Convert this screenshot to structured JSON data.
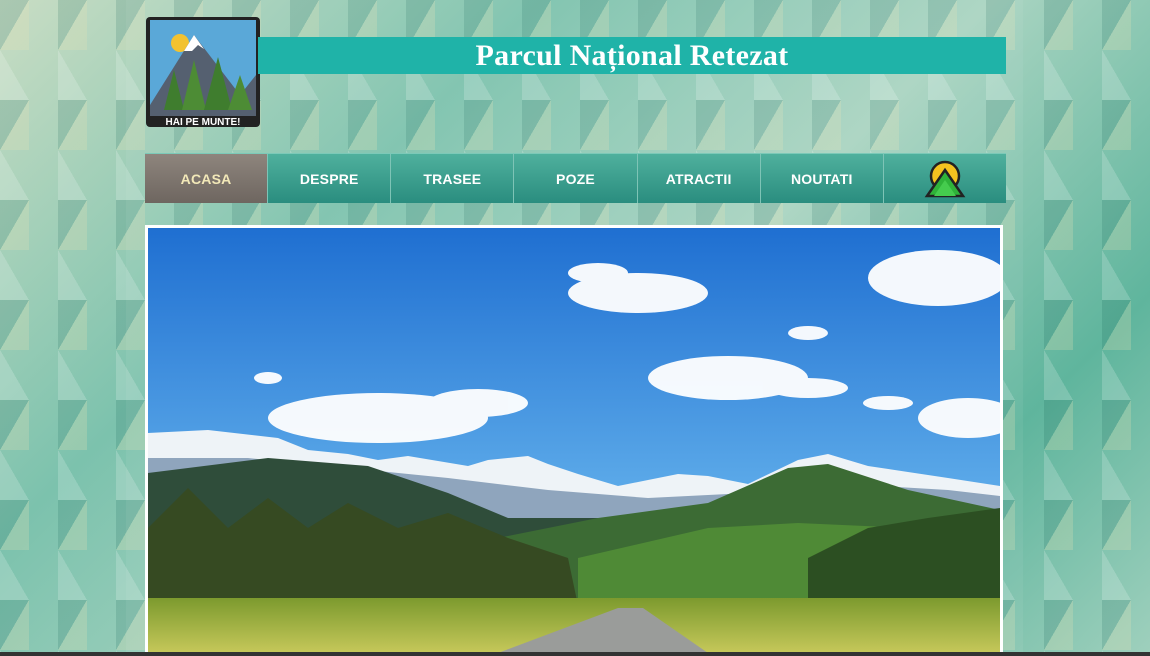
{
  "header": {
    "logo_text": "HAI PE MUNTE!",
    "title": "Parcul Național Retezat"
  },
  "nav": {
    "items": [
      {
        "label": "ACASA",
        "active": true
      },
      {
        "label": "DESPRE",
        "active": false
      },
      {
        "label": "TRASEE",
        "active": false
      },
      {
        "label": "POZE",
        "active": false
      },
      {
        "label": "ATRACTII",
        "active": false
      },
      {
        "label": "NOUTATI",
        "active": false
      }
    ],
    "extra_icon": "mountain-sun-icon"
  },
  "hero": {
    "image_label": "mountain-landscape-image"
  },
  "colors": {
    "title_bar": "#1fb3a8",
    "nav": "#2f9685",
    "nav_active": "#7a726b",
    "active_text": "#f2e8b8"
  }
}
